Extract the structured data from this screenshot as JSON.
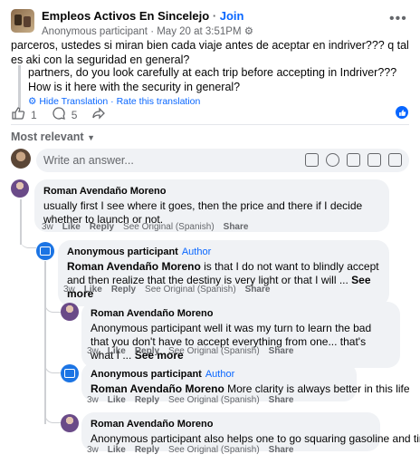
{
  "post": {
    "group_name": "Empleos Activos En Sincelejo",
    "join_label": "Join",
    "author": "Anonymous participant",
    "date": "May 20 at 3:51PM",
    "text": "parceros, ustedes si miran bien cada viaje antes de aceptar en indriver??? q tal es aki con la seguridad en general?",
    "translation": "partners, do you look carefully at each trip before accepting in Indriver??? How is it here with the security in general?",
    "hide_translation": "Hide Translation",
    "rate_translation": "Rate this translation",
    "likes": "1",
    "comments": "5"
  },
  "sort_label": "Most relevant",
  "answer_placeholder": "Write an answer...",
  "comments": [
    {
      "author": "Roman Avendaño Moreno",
      "text": "usually first I see where it goes, then the price and there if I decide whether to launch or not.",
      "time": "3w",
      "like": "Like",
      "reply": "Reply",
      "see_original": "See Original (Spanish)",
      "share": "Share"
    },
    {
      "author": "Anonymous participant",
      "badge": "Author",
      "mention": "Roman Avendaño Moreno",
      "text": " is that I do not want to blindly accept and then realize that the destiny is very light or that I will ...",
      "more": "See more",
      "time": "3w",
      "like": "Like",
      "reply": "Reply",
      "see_original": "See Original (Spanish)",
      "share": "Share"
    },
    {
      "author": "Roman Avendaño Moreno",
      "text": "Anonymous participant well it was my turn to learn the bad that you don't have to accept everything from one... that's what I ...",
      "more": "See more",
      "time": "3w",
      "like": "Like",
      "reply": "Reply",
      "see_original": "See Original (Spanish)",
      "share": "Share"
    },
    {
      "author": "Anonymous participant",
      "badge": "Author",
      "mention": "Roman Avendaño Moreno",
      "text": " More clarity is always better in this life",
      "time": "3w",
      "like": "Like",
      "reply": "Reply",
      "see_original": "See Original (Spanish)",
      "share": "Share"
    },
    {
      "author": "Roman Avendaño Moreno",
      "text": "Anonymous participant also helps one to go squaring gasoline and time",
      "time": "3w",
      "like": "Like",
      "reply": "Reply",
      "see_original": "See Original (Spanish)",
      "share": "Share"
    }
  ]
}
